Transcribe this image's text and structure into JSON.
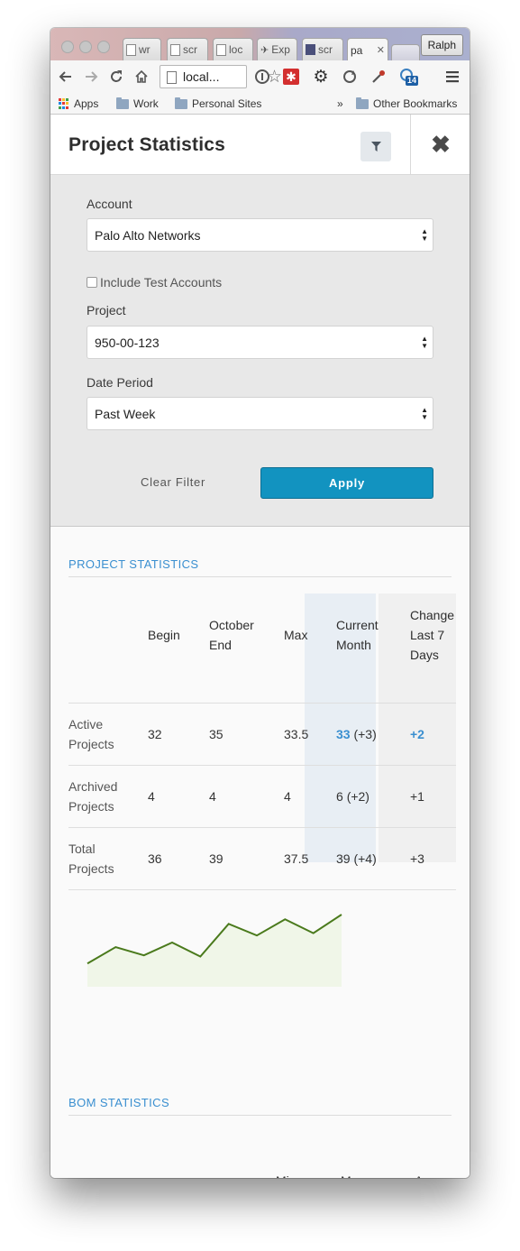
{
  "browser": {
    "tabs": [
      {
        "label": "wr"
      },
      {
        "label": "scr"
      },
      {
        "label": "loc"
      },
      {
        "label": "Exp"
      },
      {
        "label": "scr"
      },
      {
        "label": "pa",
        "active": true
      }
    ],
    "tab_close": "✕",
    "profile": "Ralph",
    "url": "local...",
    "extension_badge": "14",
    "bookmarks": {
      "apps": "Apps",
      "work": "Work",
      "personal_sites": "Personal Sites",
      "overflow": "»",
      "other": "Other Bookmarks"
    }
  },
  "header": {
    "title": "Project Statistics",
    "close": "✖"
  },
  "filters": {
    "account_label": "Account",
    "account_value": "Palo Alto Networks",
    "include_test_label": "Include Test Accounts",
    "include_test_checked": false,
    "project_label": "Project",
    "project_value": "950-00-123",
    "date_label": "Date Period",
    "date_value": "Past Week",
    "clear_label": "Clear Filter",
    "apply_label": "Apply"
  },
  "project_stats": {
    "heading": "PROJECT STATISTICS",
    "columns": {
      "begin": "Begin",
      "oct_end_1": "October",
      "oct_end_2": "End",
      "max": "Max",
      "current_1": "Current",
      "current_2": "Month",
      "change_1": "Change",
      "change_2": "Last 7",
      "change_3": "Days"
    },
    "rows": [
      {
        "label_1": "Active",
        "label_2": "Projects",
        "begin": "32",
        "oct_end": "35",
        "max": "33.5",
        "current": "33",
        "current_delta": "(+3)",
        "change": "+2"
      },
      {
        "label_1": "Archived",
        "label_2": "Projects",
        "begin": "4",
        "oct_end": "4",
        "max": "4",
        "current": "6",
        "current_delta": "(+2)",
        "change": "+1"
      },
      {
        "label_1": "Total",
        "label_2": "Projects",
        "begin": "36",
        "oct_end": "39",
        "max": "37.5",
        "current": "39",
        "current_delta": "(+4)",
        "change": "+3"
      }
    ],
    "line_color": "#4a7a1c",
    "fill_color": "#f0f6e8",
    "trend": [
      20,
      34,
      27,
      38,
      26,
      54,
      44,
      58,
      46,
      62
    ]
  },
  "bom_stats": {
    "heading": "BOM STATISTICS",
    "columns": {
      "min": "Min",
      "max": "Max",
      "avg": "Avg"
    }
  },
  "colors": {
    "accent": "#1293c0",
    "link": "#3a8fd0"
  }
}
